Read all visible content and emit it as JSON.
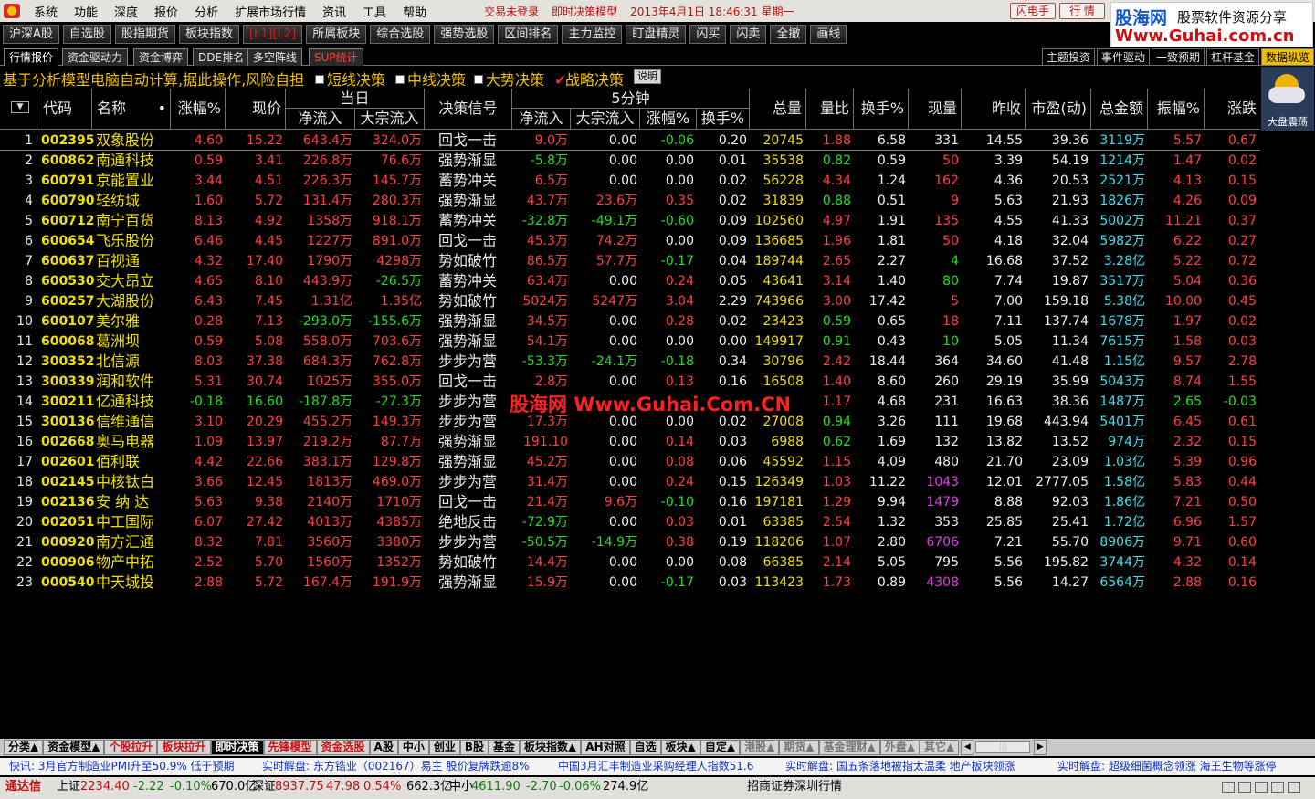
{
  "menu": [
    "系统",
    "功能",
    "深度",
    "报价",
    "分析",
    "扩展市场行情",
    "资讯",
    "工具",
    "帮助"
  ],
  "status_top": {
    "login": "交易未登录",
    "model": "即时决策模型",
    "datetime": "2013年4月1日 18:46:31 星期一"
  },
  "top_buttons": {
    "flash": "闪电手",
    "quote": "行 情"
  },
  "brand": {
    "name": "股海网",
    "slogan": "股票软件资源分享",
    "url": "Www.Guhai.com.cn"
  },
  "toolbar": [
    "沪深A股",
    "自选股",
    "股指期货",
    "板块指数",
    "[L1][L2]",
    "所属板块",
    "综合选股",
    "强势选股",
    "区间排名",
    "主力监控",
    "盯盘精灵",
    "闪买",
    "闪卖",
    "全撤",
    "画线"
  ],
  "tabs": [
    "行情报价",
    "资金驱动力",
    "资金博弈",
    "DDE排名",
    "多空阵线",
    "SUP统计"
  ],
  "right_tabs": [
    "主题投资",
    "事件驱动",
    "一致预期",
    "杠杆基金",
    "数据纵览"
  ],
  "info": {
    "desc": "基于分析模型电脑自动计算,据此操作,风险自担",
    "checks": [
      "短线决策",
      "中线决策",
      "大势决策",
      "战略决策"
    ],
    "help": "说明"
  },
  "weather_label": "大盘震荡",
  "headers": {
    "sort": "▼",
    "code": "代码",
    "name": "名称",
    "dot": "•",
    "chg": "涨幅%",
    "price": "现价",
    "today": "当日",
    "net_in": "净流入",
    "big_in": "大宗流入",
    "signal": "决策信号",
    "min5": "5分钟",
    "m_net_in": "净流入",
    "m_big_in": "大宗流入",
    "m_chg": "涨幅%",
    "m_turn": "换手%",
    "vol": "总量",
    "vr": "量比",
    "turn": "换手%",
    "cur_vol": "现量",
    "prev": "昨收",
    "pe": "市盈(动)",
    "amount": "总金额",
    "amp": "振幅%",
    "updown": "涨跌"
  },
  "rows": [
    [
      "1",
      "002395",
      "双象股份",
      "4.60",
      "15.22",
      "643.4万",
      "324.0万",
      "回戈一击",
      "9.0万",
      "0.00",
      "-0.06",
      "0.20",
      "20745",
      "1.88",
      "6.58",
      "331",
      "14.55",
      "39.36",
      "3119万",
      "5.57",
      "0.67"
    ],
    [
      "2",
      "600862",
      "南通科技",
      "0.59",
      "3.41",
      "226.8万",
      "76.6万",
      "强势渐显",
      "-5.8万",
      "0.00",
      "0.00",
      "0.01",
      "35538",
      "0.82",
      "0.59",
      "50",
      "3.39",
      "54.19",
      "1214万",
      "1.47",
      "0.02"
    ],
    [
      "3",
      "600791",
      "京能置业",
      "3.44",
      "4.51",
      "226.3万",
      "145.7万",
      "蓄势冲关",
      "6.5万",
      "0.00",
      "0.00",
      "0.02",
      "56228",
      "4.34",
      "1.24",
      "162",
      "4.36",
      "20.53",
      "2521万",
      "4.13",
      "0.15"
    ],
    [
      "4",
      "600790",
      "轻纺城",
      "1.60",
      "5.72",
      "131.4万",
      "280.3万",
      "强势渐显",
      "43.7万",
      "23.6万",
      "0.35",
      "0.02",
      "31839",
      "0.88",
      "0.51",
      "9",
      "5.63",
      "21.93",
      "1826万",
      "4.26",
      "0.09"
    ],
    [
      "5",
      "600712",
      "南宁百货",
      "8.13",
      "4.92",
      "1358万",
      "918.1万",
      "蓄势冲关",
      "-32.8万",
      "-49.1万",
      "-0.60",
      "0.09",
      "102560",
      "4.97",
      "1.91",
      "135",
      "4.55",
      "41.33",
      "5002万",
      "11.21",
      "0.37"
    ],
    [
      "6",
      "600654",
      "飞乐股份",
      "6.46",
      "4.45",
      "1227万",
      "891.0万",
      "回戈一击",
      "45.3万",
      "74.2万",
      "0.00",
      "0.09",
      "136685",
      "1.96",
      "1.81",
      "50",
      "4.18",
      "32.04",
      "5982万",
      "6.22",
      "0.27"
    ],
    [
      "7",
      "600637",
      "百视通",
      "4.32",
      "17.40",
      "1790万",
      "4298万",
      "势如破竹",
      "86.5万",
      "57.7万",
      "-0.17",
      "0.04",
      "189744",
      "2.65",
      "2.27",
      "4",
      "16.68",
      "37.52",
      "3.28亿",
      "5.22",
      "0.72"
    ],
    [
      "8",
      "600530",
      "交大昂立",
      "4.65",
      "8.10",
      "443.9万",
      "-26.5万",
      "蓄势冲关",
      "63.4万",
      "0.00",
      "0.24",
      "0.05",
      "43641",
      "3.14",
      "1.40",
      "80",
      "7.74",
      "19.87",
      "3517万",
      "5.04",
      "0.36"
    ],
    [
      "9",
      "600257",
      "大湖股份",
      "6.43",
      "7.45",
      "1.31亿",
      "1.35亿",
      "势如破竹",
      "5024万",
      "5247万",
      "3.04",
      "2.29",
      "743966",
      "3.00",
      "17.42",
      "5",
      "7.00",
      "159.18",
      "5.38亿",
      "10.00",
      "0.45"
    ],
    [
      "10",
      "600107",
      "美尔雅",
      "0.28",
      "7.13",
      "-293.0万",
      "-155.6万",
      "强势渐显",
      "34.5万",
      "0.00",
      "0.28",
      "0.02",
      "23423",
      "0.59",
      "0.65",
      "18",
      "7.11",
      "137.74",
      "1678万",
      "1.97",
      "0.02"
    ],
    [
      "11",
      "600068",
      "葛洲坝",
      "0.59",
      "5.08",
      "558.0万",
      "703.6万",
      "强势渐显",
      "54.1万",
      "0.00",
      "0.00",
      "0.00",
      "149917",
      "0.91",
      "0.43",
      "10",
      "5.05",
      "11.34",
      "7615万",
      "1.58",
      "0.03"
    ],
    [
      "12",
      "300352",
      "北信源",
      "8.03",
      "37.38",
      "684.3万",
      "762.8万",
      "步步为营",
      "-53.3万",
      "-24.1万",
      "-0.18",
      "0.34",
      "30796",
      "2.42",
      "18.44",
      "364",
      "34.60",
      "41.48",
      "1.15亿",
      "9.57",
      "2.78"
    ],
    [
      "13",
      "300339",
      "润和软件",
      "5.31",
      "30.74",
      "1025万",
      "355.0万",
      "回戈一击",
      "2.8万",
      "0.00",
      "0.13",
      "0.16",
      "16508",
      "1.40",
      "8.60",
      "260",
      "29.19",
      "35.99",
      "5043万",
      "8.74",
      "1.55"
    ],
    [
      "14",
      "300211",
      "亿通科技",
      "-0.18",
      "16.60",
      "-187.8万",
      "-27.3万",
      "步步为营",
      "",
      "",
      "",
      "",
      "",
      "1.17",
      "4.68",
      "231",
      "16.63",
      "38.36",
      "1487万",
      "2.65",
      "-0.03"
    ],
    [
      "15",
      "300136",
      "信维通信",
      "3.10",
      "20.29",
      "455.2万",
      "149.3万",
      "步步为营",
      "17.3万",
      "0.00",
      "0.00",
      "0.02",
      "27008",
      "0.94",
      "3.26",
      "111",
      "19.68",
      "443.94",
      "5401万",
      "6.45",
      "0.61"
    ],
    [
      "16",
      "002668",
      "奥马电器",
      "1.09",
      "13.97",
      "219.2万",
      "87.7万",
      "强势渐显",
      "191.10",
      "0.00",
      "0.14",
      "0.03",
      "6988",
      "0.62",
      "1.69",
      "132",
      "13.82",
      "13.52",
      "974万",
      "2.32",
      "0.15"
    ],
    [
      "17",
      "002601",
      "佰利联",
      "4.42",
      "22.66",
      "383.1万",
      "129.8万",
      "强势渐显",
      "45.2万",
      "0.00",
      "0.08",
      "0.06",
      "45592",
      "1.15",
      "4.09",
      "480",
      "21.70",
      "23.09",
      "1.03亿",
      "5.39",
      "0.96"
    ],
    [
      "18",
      "002145",
      "中核钛白",
      "3.66",
      "12.45",
      "1813万",
      "469.0万",
      "步步为营",
      "31.4万",
      "0.00",
      "0.24",
      "0.15",
      "126349",
      "1.03",
      "11.22",
      "1043",
      "12.01",
      "2777.05",
      "1.58亿",
      "5.83",
      "0.44"
    ],
    [
      "19",
      "002136",
      "安 纳 达",
      "5.63",
      "9.38",
      "2140万",
      "1710万",
      "回戈一击",
      "21.4万",
      "9.6万",
      "-0.10",
      "0.16",
      "197181",
      "1.29",
      "9.94",
      "1479",
      "8.88",
      "92.03",
      "1.86亿",
      "7.21",
      "0.50"
    ],
    [
      "20",
      "002051",
      "中工国际",
      "6.07",
      "27.42",
      "4013万",
      "4385万",
      "绝地反击",
      "-72.9万",
      "0.00",
      "0.03",
      "0.01",
      "63385",
      "2.54",
      "1.32",
      "353",
      "25.85",
      "25.41",
      "1.72亿",
      "6.96",
      "1.57"
    ],
    [
      "21",
      "000920",
      "南方汇通",
      "8.32",
      "7.81",
      "3560万",
      "3380万",
      "步步为营",
      "-50.5万",
      "-14.9万",
      "0.38",
      "0.19",
      "118206",
      "1.07",
      "2.80",
      "6706",
      "7.21",
      "55.70",
      "8906万",
      "9.71",
      "0.60"
    ],
    [
      "22",
      "000906",
      "物产中拓",
      "2.52",
      "5.70",
      "1560万",
      "1352万",
      "势如破竹",
      "14.4万",
      "0.00",
      "0.00",
      "0.08",
      "66385",
      "2.14",
      "5.05",
      "795",
      "5.56",
      "195.82",
      "3744万",
      "4.32",
      "0.14"
    ],
    [
      "23",
      "000540",
      "中天城投",
      "2.88",
      "5.72",
      "167.4万",
      "191.9万",
      "强势渐显",
      "15.9万",
      "0.00",
      "-0.17",
      "0.03",
      "113423",
      "1.73",
      "0.89",
      "4308",
      "5.56",
      "14.27",
      "6564万",
      "2.88",
      "0.16"
    ]
  ],
  "watermark": "股海网 Www.Guhai.Com.CN",
  "bottom_tabs": [
    "分类▲",
    "资金模型▲",
    "个股拉升",
    "板块拉升",
    "即时决策",
    "先锋模型",
    "资金选股",
    "A股",
    "中小",
    "创业",
    "B股",
    "基金",
    "板块指数▲",
    "AH对照",
    "自选",
    "板块▲",
    "自定▲",
    "港股▲",
    "期货▲",
    "基金理财▲",
    "外盘▲",
    "其它▲"
  ],
  "ticker": [
    "快讯: 3月官方制造业PMI升至50.9% 低于预期",
    "实时解盘: 东方锆业（002167）易主 股价复牌跌逾8%",
    "中国3月汇丰制造业采购经理人指数51.6",
    "实时解盘: 国五条落地被指太温柔 地产板块领涨",
    "实时解盘: 超级细菌概念领涨 海王生物等涨停"
  ],
  "statusbar": {
    "app": "通达信",
    "sh_label": "上证",
    "sh": "2234.40",
    "sh_chg": "-2.22",
    "sh_pct": "-0.10%",
    "sh_amt": "670.0亿",
    "sz_label": "深证",
    "sz": "8937.75",
    "sz_chg": "47.98",
    "sz_pct": "0.54%",
    "sz_amt": "662.3亿",
    "zx_label": "中小",
    "zx": "4611.90",
    "zx_chg": "-2.70",
    "zx_pct": "-0.06%",
    "zx_amt": "274.9亿",
    "broker": "招商证券深圳行情"
  },
  "colors": {
    "up": "#ff4040",
    "down": "#20e020",
    "flat": "#f0f0f0",
    "code": "#f0e000",
    "amount": "#40e0f0",
    "volume_big": "#e040e0"
  }
}
